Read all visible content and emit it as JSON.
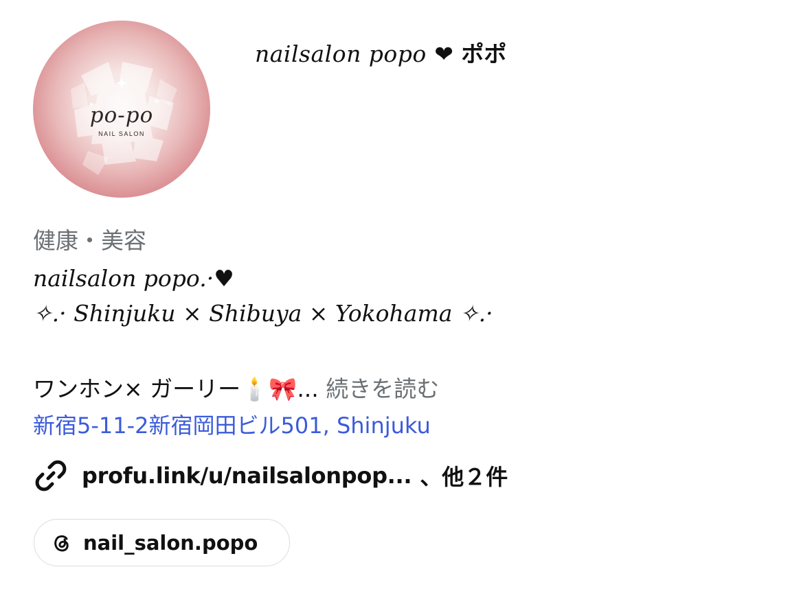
{
  "profile": {
    "avatar_logo_script": "po-po",
    "avatar_logo_sub": "NAIL SALON",
    "display_name": "nailsalon popo",
    "display_name_tail": " ❤ ポポ"
  },
  "bio": {
    "category": "健康・美容",
    "name_line": "nailsalon popo.·♥",
    "location_line": "✧.· Shinjuku × Shibuya × Yokohama ✧.·",
    "tagline": "ワンホン× ガーリー🕯️🎀...",
    "more_label": " 続きを読む",
    "address": "新宿5-11-2新宿岡田ビル501, Shinjuku"
  },
  "links": {
    "url": "profu.link/u/nailsalonpop...",
    "more": "、他２件",
    "icon": "link-icon"
  },
  "threads": {
    "handle": "nail_salon.popo",
    "icon": "threads-icon"
  },
  "colors": {
    "link_blue": "#3b5bdb",
    "secondary_text": "#6b7074",
    "avatar_pink": "#d8898d"
  }
}
